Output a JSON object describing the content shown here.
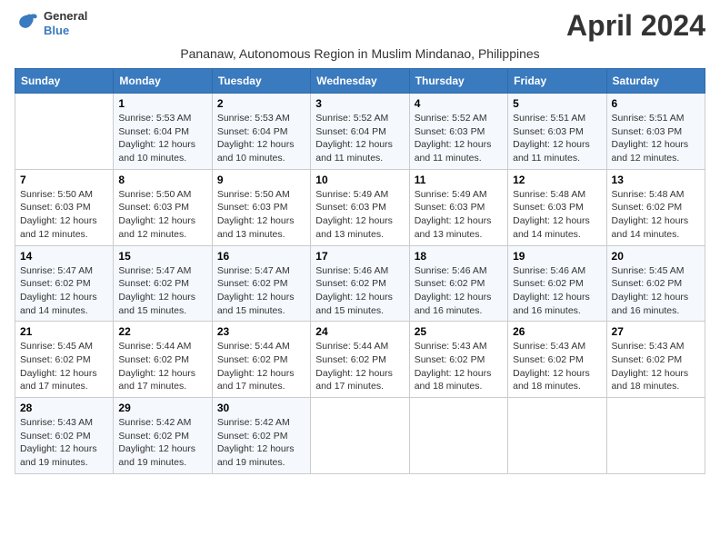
{
  "logo": {
    "line1": "General",
    "line2": "Blue"
  },
  "title": "April 2024",
  "subtitle": "Pananaw, Autonomous Region in Muslim Mindanao, Philippines",
  "days_of_week": [
    "Sunday",
    "Monday",
    "Tuesday",
    "Wednesday",
    "Thursday",
    "Friday",
    "Saturday"
  ],
  "weeks": [
    [
      {
        "num": "",
        "sunrise": "",
        "sunset": "",
        "daylight": ""
      },
      {
        "num": "1",
        "sunrise": "Sunrise: 5:53 AM",
        "sunset": "Sunset: 6:04 PM",
        "daylight": "Daylight: 12 hours and 10 minutes."
      },
      {
        "num": "2",
        "sunrise": "Sunrise: 5:53 AM",
        "sunset": "Sunset: 6:04 PM",
        "daylight": "Daylight: 12 hours and 10 minutes."
      },
      {
        "num": "3",
        "sunrise": "Sunrise: 5:52 AM",
        "sunset": "Sunset: 6:04 PM",
        "daylight": "Daylight: 12 hours and 11 minutes."
      },
      {
        "num": "4",
        "sunrise": "Sunrise: 5:52 AM",
        "sunset": "Sunset: 6:03 PM",
        "daylight": "Daylight: 12 hours and 11 minutes."
      },
      {
        "num": "5",
        "sunrise": "Sunrise: 5:51 AM",
        "sunset": "Sunset: 6:03 PM",
        "daylight": "Daylight: 12 hours and 11 minutes."
      },
      {
        "num": "6",
        "sunrise": "Sunrise: 5:51 AM",
        "sunset": "Sunset: 6:03 PM",
        "daylight": "Daylight: 12 hours and 12 minutes."
      }
    ],
    [
      {
        "num": "7",
        "sunrise": "Sunrise: 5:50 AM",
        "sunset": "Sunset: 6:03 PM",
        "daylight": "Daylight: 12 hours and 12 minutes."
      },
      {
        "num": "8",
        "sunrise": "Sunrise: 5:50 AM",
        "sunset": "Sunset: 6:03 PM",
        "daylight": "Daylight: 12 hours and 12 minutes."
      },
      {
        "num": "9",
        "sunrise": "Sunrise: 5:50 AM",
        "sunset": "Sunset: 6:03 PM",
        "daylight": "Daylight: 12 hours and 13 minutes."
      },
      {
        "num": "10",
        "sunrise": "Sunrise: 5:49 AM",
        "sunset": "Sunset: 6:03 PM",
        "daylight": "Daylight: 12 hours and 13 minutes."
      },
      {
        "num": "11",
        "sunrise": "Sunrise: 5:49 AM",
        "sunset": "Sunset: 6:03 PM",
        "daylight": "Daylight: 12 hours and 13 minutes."
      },
      {
        "num": "12",
        "sunrise": "Sunrise: 5:48 AM",
        "sunset": "Sunset: 6:03 PM",
        "daylight": "Daylight: 12 hours and 14 minutes."
      },
      {
        "num": "13",
        "sunrise": "Sunrise: 5:48 AM",
        "sunset": "Sunset: 6:02 PM",
        "daylight": "Daylight: 12 hours and 14 minutes."
      }
    ],
    [
      {
        "num": "14",
        "sunrise": "Sunrise: 5:47 AM",
        "sunset": "Sunset: 6:02 PM",
        "daylight": "Daylight: 12 hours and 14 minutes."
      },
      {
        "num": "15",
        "sunrise": "Sunrise: 5:47 AM",
        "sunset": "Sunset: 6:02 PM",
        "daylight": "Daylight: 12 hours and 15 minutes."
      },
      {
        "num": "16",
        "sunrise": "Sunrise: 5:47 AM",
        "sunset": "Sunset: 6:02 PM",
        "daylight": "Daylight: 12 hours and 15 minutes."
      },
      {
        "num": "17",
        "sunrise": "Sunrise: 5:46 AM",
        "sunset": "Sunset: 6:02 PM",
        "daylight": "Daylight: 12 hours and 15 minutes."
      },
      {
        "num": "18",
        "sunrise": "Sunrise: 5:46 AM",
        "sunset": "Sunset: 6:02 PM",
        "daylight": "Daylight: 12 hours and 16 minutes."
      },
      {
        "num": "19",
        "sunrise": "Sunrise: 5:46 AM",
        "sunset": "Sunset: 6:02 PM",
        "daylight": "Daylight: 12 hours and 16 minutes."
      },
      {
        "num": "20",
        "sunrise": "Sunrise: 5:45 AM",
        "sunset": "Sunset: 6:02 PM",
        "daylight": "Daylight: 12 hours and 16 minutes."
      }
    ],
    [
      {
        "num": "21",
        "sunrise": "Sunrise: 5:45 AM",
        "sunset": "Sunset: 6:02 PM",
        "daylight": "Daylight: 12 hours and 17 minutes."
      },
      {
        "num": "22",
        "sunrise": "Sunrise: 5:44 AM",
        "sunset": "Sunset: 6:02 PM",
        "daylight": "Daylight: 12 hours and 17 minutes."
      },
      {
        "num": "23",
        "sunrise": "Sunrise: 5:44 AM",
        "sunset": "Sunset: 6:02 PM",
        "daylight": "Daylight: 12 hours and 17 minutes."
      },
      {
        "num": "24",
        "sunrise": "Sunrise: 5:44 AM",
        "sunset": "Sunset: 6:02 PM",
        "daylight": "Daylight: 12 hours and 17 minutes."
      },
      {
        "num": "25",
        "sunrise": "Sunrise: 5:43 AM",
        "sunset": "Sunset: 6:02 PM",
        "daylight": "Daylight: 12 hours and 18 minutes."
      },
      {
        "num": "26",
        "sunrise": "Sunrise: 5:43 AM",
        "sunset": "Sunset: 6:02 PM",
        "daylight": "Daylight: 12 hours and 18 minutes."
      },
      {
        "num": "27",
        "sunrise": "Sunrise: 5:43 AM",
        "sunset": "Sunset: 6:02 PM",
        "daylight": "Daylight: 12 hours and 18 minutes."
      }
    ],
    [
      {
        "num": "28",
        "sunrise": "Sunrise: 5:43 AM",
        "sunset": "Sunset: 6:02 PM",
        "daylight": "Daylight: 12 hours and 19 minutes."
      },
      {
        "num": "29",
        "sunrise": "Sunrise: 5:42 AM",
        "sunset": "Sunset: 6:02 PM",
        "daylight": "Daylight: 12 hours and 19 minutes."
      },
      {
        "num": "30",
        "sunrise": "Sunrise: 5:42 AM",
        "sunset": "Sunset: 6:02 PM",
        "daylight": "Daylight: 12 hours and 19 minutes."
      },
      {
        "num": "",
        "sunrise": "",
        "sunset": "",
        "daylight": ""
      },
      {
        "num": "",
        "sunrise": "",
        "sunset": "",
        "daylight": ""
      },
      {
        "num": "",
        "sunrise": "",
        "sunset": "",
        "daylight": ""
      },
      {
        "num": "",
        "sunrise": "",
        "sunset": "",
        "daylight": ""
      }
    ]
  ]
}
